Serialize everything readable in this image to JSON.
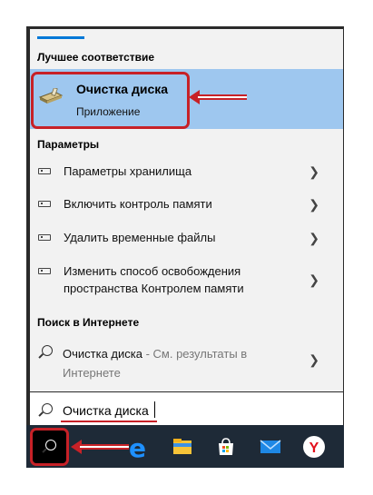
{
  "sections": {
    "best_match": "Лучшее соответствие",
    "settings": "Параметры",
    "web": "Поиск в Интернете"
  },
  "best_match_item": {
    "title": "Очистка диска",
    "subtitle": "Приложение"
  },
  "settings_items": [
    {
      "label": "Параметры хранилища"
    },
    {
      "label": "Включить контроль памяти"
    },
    {
      "label": "Удалить временные файлы"
    },
    {
      "label": "Изменить способ освобождения пространства Контролем памяти"
    }
  ],
  "web_item": {
    "query": "Очистка диска",
    "suffix": " - См. результаты в Интернете"
  },
  "search": {
    "value": "Очистка диска"
  },
  "taskbar": {
    "icons": [
      "search-icon",
      "task-view-icon",
      "edge-icon",
      "file-explorer-icon",
      "store-icon",
      "mail-icon",
      "yandex-browser-icon"
    ]
  },
  "colors": {
    "accent": "#0078d7",
    "highlight": "#9ec7ef",
    "annotation": "#c72127",
    "taskbar": "#1e2a37"
  }
}
